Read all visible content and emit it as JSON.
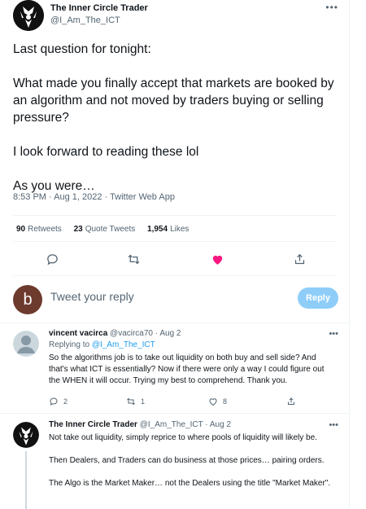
{
  "tweet": {
    "author": {
      "name": "The Inner Circle Trader",
      "handle": "@I_Am_The_ICT"
    },
    "more_icon": "ellipsis-icon",
    "paragraphs": [
      "Last question for tonight:",
      "What made you finally accept that markets are booked by an algorithm and not moved by traders buying or selling pressure?",
      "I look forward to reading these lol",
      "As you were…"
    ],
    "time": "8:53 PM · Aug 1, 2022",
    "client": "Twitter Web App",
    "stats": {
      "retweets_count": "90",
      "retweets_label": "Retweets",
      "quotes_count": "23",
      "quotes_label": "Quote Tweets",
      "likes_count": "1,954",
      "likes_label": "Likes"
    },
    "actions": [
      "reply-icon",
      "retweet-icon",
      "heart-filled-icon",
      "share-icon"
    ],
    "like_color": "#f91880"
  },
  "composer": {
    "avatar_letter": "b",
    "avatar_color": "#6d3a2e",
    "placeholder": "Tweet your reply",
    "button_label": "Reply",
    "button_color": "#8ecdf8"
  },
  "replies": [
    {
      "name": "vincent vacirca",
      "handle": "@vacirca70",
      "date": "· Aug 2",
      "replying_prefix": "Replying to",
      "replying_to": "@I_Am_The_ICT",
      "text": "So the algorithms job is to take out liquidity on both buy and sell side? And that's what ICT is essentially?  Now if there were only a way I could  figure out the WHEN it will occur.  Trying my best to comprehend.  Thank you.",
      "reply_count": "2",
      "retweet_count": "1",
      "like_count": "8"
    },
    {
      "name": "The Inner Circle Trader",
      "handle": "@I_Am_The_ICT",
      "date": "· Aug 2",
      "paragraphs": [
        "Not take out liquidity, simply reprice to where pools of liquidity will likely be.",
        "Then Dealers, and Traders can do business at those prices… pairing orders.",
        "The Algo is the Market Maker… not the Dealers using the title \"Market Maker\"."
      ]
    }
  ]
}
